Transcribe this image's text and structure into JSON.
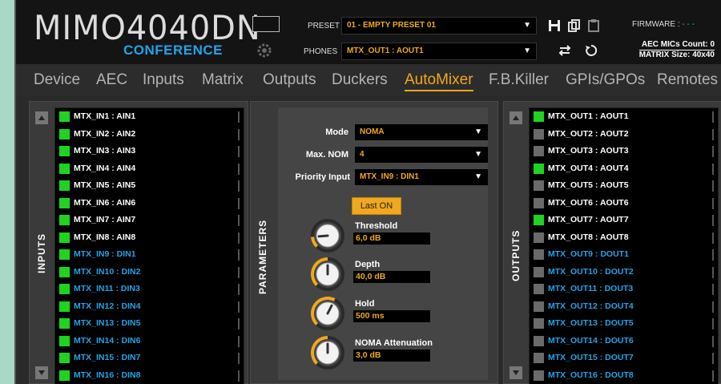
{
  "brand": {
    "name": "MIMO4040DN",
    "sub": "CONFERENCE"
  },
  "header": {
    "preset_label": "PRESET",
    "preset_value": "01 - EMPTY PRESET 01",
    "phones_label": "PHONES",
    "phones_value": "MTX_OUT1 : AOUT1",
    "firmware_label": "FIRMWARE :",
    "firmware_value": "- - -",
    "aec_count": "AEC MICs Count: 0",
    "matrix_size": "MATRIX Size: 40x40",
    "dropdown_arrow": "▼"
  },
  "nav": [
    "Device",
    "AEC",
    "Inputs",
    "Matrix",
    "Outputs",
    "Duckers",
    "AutoMixer",
    "F.B.Killer",
    "GPIs/GPOs",
    "Remotes"
  ],
  "active_tab": "AutoMixer",
  "inputs": {
    "title": "INPUTS",
    "items": [
      {
        "label": "MTX_IN1 : AIN1",
        "on": true,
        "type": "analog"
      },
      {
        "label": "MTX_IN2 : AIN2",
        "on": true,
        "type": "analog"
      },
      {
        "label": "MTX_IN3 : AIN3",
        "on": true,
        "type": "analog"
      },
      {
        "label": "MTX_IN4 : AIN4",
        "on": true,
        "type": "analog"
      },
      {
        "label": "MTX_IN5 : AIN5",
        "on": true,
        "type": "analog"
      },
      {
        "label": "MTX_IN6 : AIN6",
        "on": true,
        "type": "analog"
      },
      {
        "label": "MTX_IN7 : AIN7",
        "on": true,
        "type": "analog"
      },
      {
        "label": "MTX_IN8 : AIN8",
        "on": true,
        "type": "analog"
      },
      {
        "label": "MTX_IN9 : DIN1",
        "on": true,
        "type": "digital"
      },
      {
        "label": "MTX_IN10 : DIN2",
        "on": true,
        "type": "digital"
      },
      {
        "label": "MTX_IN11 : DIN3",
        "on": true,
        "type": "digital"
      },
      {
        "label": "MTX_IN12 : DIN4",
        "on": true,
        "type": "digital"
      },
      {
        "label": "MTX_IN13 : DIN5",
        "on": true,
        "type": "digital"
      },
      {
        "label": "MTX_IN14 : DIN6",
        "on": true,
        "type": "digital"
      },
      {
        "label": "MTX_IN15 : DIN7",
        "on": true,
        "type": "digital"
      },
      {
        "label": "MTX_IN16 : DIN8",
        "on": true,
        "type": "digital"
      }
    ]
  },
  "parameters": {
    "title": "PARAMETERS",
    "mode_label": "Mode",
    "mode_value": "NOMA",
    "maxnom_label": "Max. NOM",
    "maxnom_value": "4",
    "priority_label": "Priority Input",
    "priority_value": "MTX_IN9 : DIN1",
    "last_on_label": "Last ON",
    "knobs": [
      {
        "name": "Threshold",
        "value": "6,0 dB",
        "level": 0.15
      },
      {
        "name": "Depth",
        "value": "40,0 dB",
        "level": 0.5
      },
      {
        "name": "Hold",
        "value": "500 ms",
        "level": 0.6
      },
      {
        "name": "NOMA Attenuation",
        "value": "3,0 dB",
        "level": 0.5
      }
    ]
  },
  "outputs": {
    "title": "OUTPUTS",
    "items": [
      {
        "label": "MTX_OUT1 : AOUT1",
        "on": true,
        "type": "analog"
      },
      {
        "label": "MTX_OUT2 : AOUT2",
        "on": false,
        "type": "analog"
      },
      {
        "label": "MTX_OUT3 : AOUT3",
        "on": false,
        "type": "analog"
      },
      {
        "label": "MTX_OUT4 : AOUT4",
        "on": true,
        "type": "analog"
      },
      {
        "label": "MTX_OUT5 : AOUT5",
        "on": false,
        "type": "analog"
      },
      {
        "label": "MTX_OUT6 : AOUT6",
        "on": false,
        "type": "analog"
      },
      {
        "label": "MTX_OUT7 : AOUT7",
        "on": true,
        "type": "analog"
      },
      {
        "label": "MTX_OUT8 : AOUT8",
        "on": false,
        "type": "analog"
      },
      {
        "label": "MTX_OUT9 : DOUT1",
        "on": false,
        "type": "digital"
      },
      {
        "label": "MTX_OUT10 : DOUT2",
        "on": false,
        "type": "digital"
      },
      {
        "label": "MTX_OUT11 : DOUT3",
        "on": false,
        "type": "digital"
      },
      {
        "label": "MTX_OUT12 : DOUT4",
        "on": false,
        "type": "digital"
      },
      {
        "label": "MTX_OUT13 : DOUT5",
        "on": false,
        "type": "digital"
      },
      {
        "label": "MTX_OUT14 : DOUT6",
        "on": false,
        "type": "digital"
      },
      {
        "label": "MTX_OUT15 : DOUT7",
        "on": false,
        "type": "digital"
      },
      {
        "label": "MTX_OUT16 : DOUT8",
        "on": false,
        "type": "digital"
      }
    ]
  },
  "colors": {
    "accent": "#f0a81c",
    "digital": "#23a3e8",
    "on": "#1ed41e",
    "off": "#6a6a6a"
  },
  "icons": [
    "save-icon",
    "copy-icon",
    "paste-icon",
    "swap-icon",
    "reset-icon",
    "gear-icon"
  ]
}
